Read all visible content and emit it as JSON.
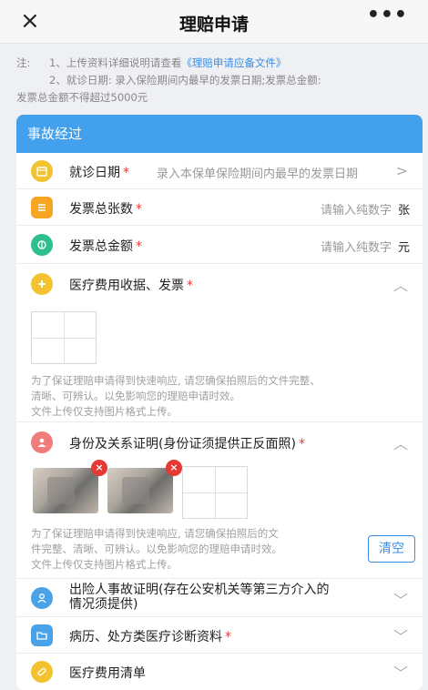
{
  "header": {
    "close_icon": "×",
    "title": "理赔申请",
    "more_icon": "•••"
  },
  "note": {
    "prefix": "注:",
    "line1_text": "1、上传资料详细说明请查看",
    "line1_link": "《理赔申请应备文件》",
    "line2": "2、就诊日期: 录入保险期间内最早的发票日期;发票总金额:",
    "line3": "发票总金额不得超过5000元"
  },
  "section": {
    "title": "事故经过",
    "visit_date": {
      "label": "就诊日期",
      "required": "*",
      "placeholder": "录入本保单保险期间内最早的发票日期",
      "chevron": ">"
    },
    "invoice_count": {
      "label": "发票总张数",
      "required": "*",
      "placeholder": "请输入纯数字",
      "unit": "张"
    },
    "invoice_amount": {
      "label": "发票总金额",
      "required": "*",
      "placeholder": "请输入纯数字",
      "unit": "元"
    },
    "receipts": {
      "label": "医疗费用收据、发票",
      "required": "*",
      "chevron": "︿"
    },
    "upload_hint": {
      "line1": "为了保证理赔申请得到快速响应, 请您确保拍照后的文件完整、",
      "line2": "清晰、可辨认。以免影响您的理赔申请时效。",
      "line3": "文件上传仅支持图片格式上传。"
    },
    "identity": {
      "label": "身份及关系证明(身份证须提供正反面照)",
      "required": "*",
      "chevron": "︿"
    },
    "identity_hint": {
      "line1": "为了保证理赔申请得到快速响应, 请您确保拍照后的文",
      "line2": "件完整、清晰、可辨认。以免影响您的理赔申请时效。",
      "line3": "文件上传仅支持图片格式上传。"
    },
    "clear_label": "清空",
    "delete_icon": "×",
    "accident_proof": {
      "label_line1": "出险人事故证明(存在公安机关等第三方介入的",
      "label_line2": "情况须提供)",
      "chevron": "﹀"
    },
    "medical_records": {
      "label": "病历、处方类医疗诊断资料",
      "required": "*",
      "chevron": "﹀"
    },
    "expense_list": {
      "label": "医疗费用清单",
      "chevron": "﹀"
    }
  },
  "colors": {
    "accent": "#42a0ec",
    "required": "#e53935",
    "link": "#3a8ee6"
  },
  "icons": {
    "calendar": "calendar-icon",
    "document": "document-icon",
    "money": "money-icon",
    "plus": "medical-plus-icon",
    "person": "person-icon",
    "folder": "folder-icon",
    "pill": "pill-icon"
  }
}
